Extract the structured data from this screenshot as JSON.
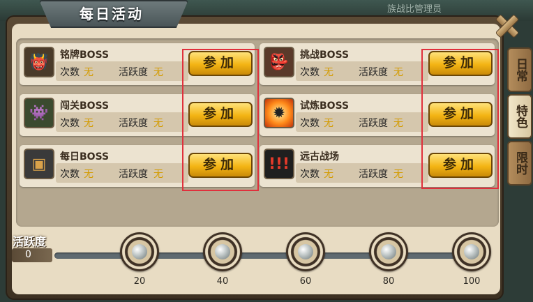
{
  "window": {
    "title": "每日活动",
    "background_text": "族战比管理员"
  },
  "tabs": [
    {
      "label": "日常",
      "active": false
    },
    {
      "label": "特色",
      "active": true
    },
    {
      "label": "限时",
      "active": false
    }
  ],
  "activities": [
    {
      "name": "铭牌BOSS",
      "count_label": "次数",
      "count_value": "无",
      "activity_label": "活跃度",
      "activity_value": "无",
      "button": "参加",
      "icon": "monster-icon"
    },
    {
      "name": "挑战BOSS",
      "count_label": "次数",
      "count_value": "无",
      "activity_label": "活跃度",
      "activity_value": "无",
      "button": "参加",
      "icon": "monster-icon"
    },
    {
      "name": "闯关BOSS",
      "count_label": "次数",
      "count_value": "无",
      "activity_label": "活跃度",
      "activity_value": "无",
      "button": "参加",
      "icon": "monster-icon"
    },
    {
      "name": "试炼BOSS",
      "count_label": "次数",
      "count_value": "无",
      "activity_label": "活跃度",
      "activity_value": "无",
      "button": "参加",
      "icon": "explosion-icon"
    },
    {
      "name": "每日BOSS",
      "count_label": "次数",
      "count_value": "无",
      "activity_label": "活跃度",
      "activity_value": "无",
      "button": "参加",
      "icon": "treasure-chest-icon"
    },
    {
      "name": "远古战场",
      "count_label": "次数",
      "count_value": "无",
      "activity_label": "活跃度",
      "activity_value": "无",
      "button": "参加",
      "icon": "intruder-icon"
    }
  ],
  "activity_bar": {
    "title": "活跃度",
    "value": "0",
    "milestones": [
      "20",
      "40",
      "60",
      "80",
      "100"
    ]
  },
  "colors": {
    "accent_gold": "#f3b414",
    "value_yellow": "#d49b00",
    "highlight_red": "#e0303c"
  }
}
